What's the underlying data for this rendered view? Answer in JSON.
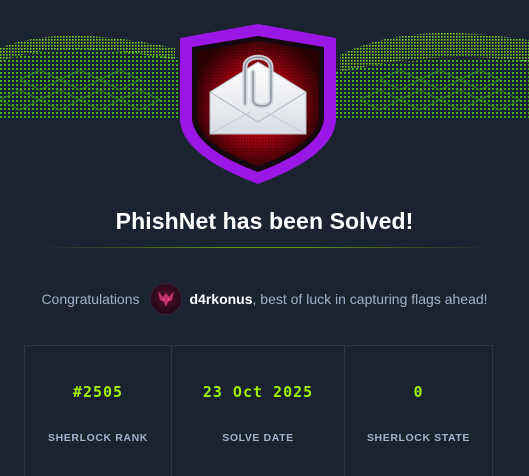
{
  "title": "PhishNet has been Solved!",
  "congrats": {
    "prefix": "Congratulations",
    "username": "d4rkonus",
    "suffix": ", best of luck in capturing flags ahead!"
  },
  "stats": [
    {
      "value": "#2505",
      "label": "SHERLOCK RANK"
    },
    {
      "value": "23 Oct 2025",
      "label": "SOLVE DATE"
    },
    {
      "value": "0",
      "label": "SHERLOCK STATE"
    }
  ],
  "icons": {
    "badge": "envelope-paperclip-icon",
    "avatar": "decepticon-avatar"
  },
  "colors": {
    "background": "#1b2230",
    "accent": "#9fef00",
    "badge_border": "#a020f0",
    "badge_inner": "#8b0000",
    "text_muted": "#a4b1cd",
    "text_primary": "#ffffff"
  }
}
